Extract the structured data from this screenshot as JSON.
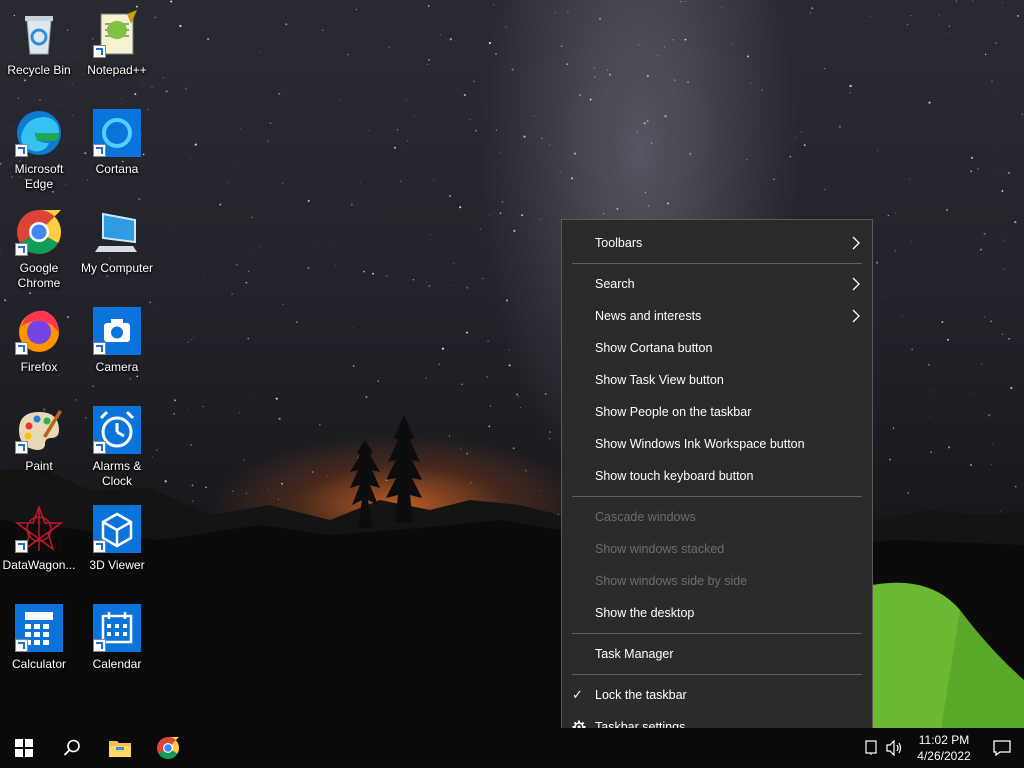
{
  "desktop": {
    "icons": [
      {
        "label": "Recycle Bin",
        "icon": "recycle-bin-icon"
      },
      {
        "label": "Notepad++",
        "icon": "notepadpp-icon"
      },
      {
        "label": "Microsoft\nEdge",
        "icon": "edge-icon"
      },
      {
        "label": "Cortana",
        "icon": "cortana-icon"
      },
      {
        "label": "Google\nChrome",
        "icon": "chrome-icon"
      },
      {
        "label": "My Computer",
        "icon": "computer-icon"
      },
      {
        "label": "Firefox",
        "icon": "firefox-icon"
      },
      {
        "label": "Camera",
        "icon": "camera-icon"
      },
      {
        "label": "Paint",
        "icon": "paint-icon"
      },
      {
        "label": "Alarms &\nClock",
        "icon": "alarm-clock-icon"
      },
      {
        "label": "DataWagon...",
        "icon": "datawagon-icon"
      },
      {
        "label": "3D Viewer",
        "icon": "3d-viewer-icon"
      },
      {
        "label": "Calculator",
        "icon": "calculator-icon"
      },
      {
        "label": "Calendar",
        "icon": "calendar-icon"
      }
    ]
  },
  "context_menu": {
    "toolbars": "Toolbars",
    "search": "Search",
    "news": "News and interests",
    "cortana": "Show Cortana button",
    "task_view": "Show Task View button",
    "people": "Show People on the taskbar",
    "ink": "Show Windows Ink Workspace button",
    "touch_kb": "Show touch keyboard button",
    "cascade": "Cascade windows",
    "stacked": "Show windows stacked",
    "side_by_side": "Show windows side by side",
    "show_desktop": "Show the desktop",
    "task_manager": "Task Manager",
    "lock": "Lock the taskbar",
    "settings": "Taskbar settings",
    "check_mark": "✓"
  },
  "taskbar": {
    "time": "11:02 PM",
    "date": "4/26/2022"
  }
}
